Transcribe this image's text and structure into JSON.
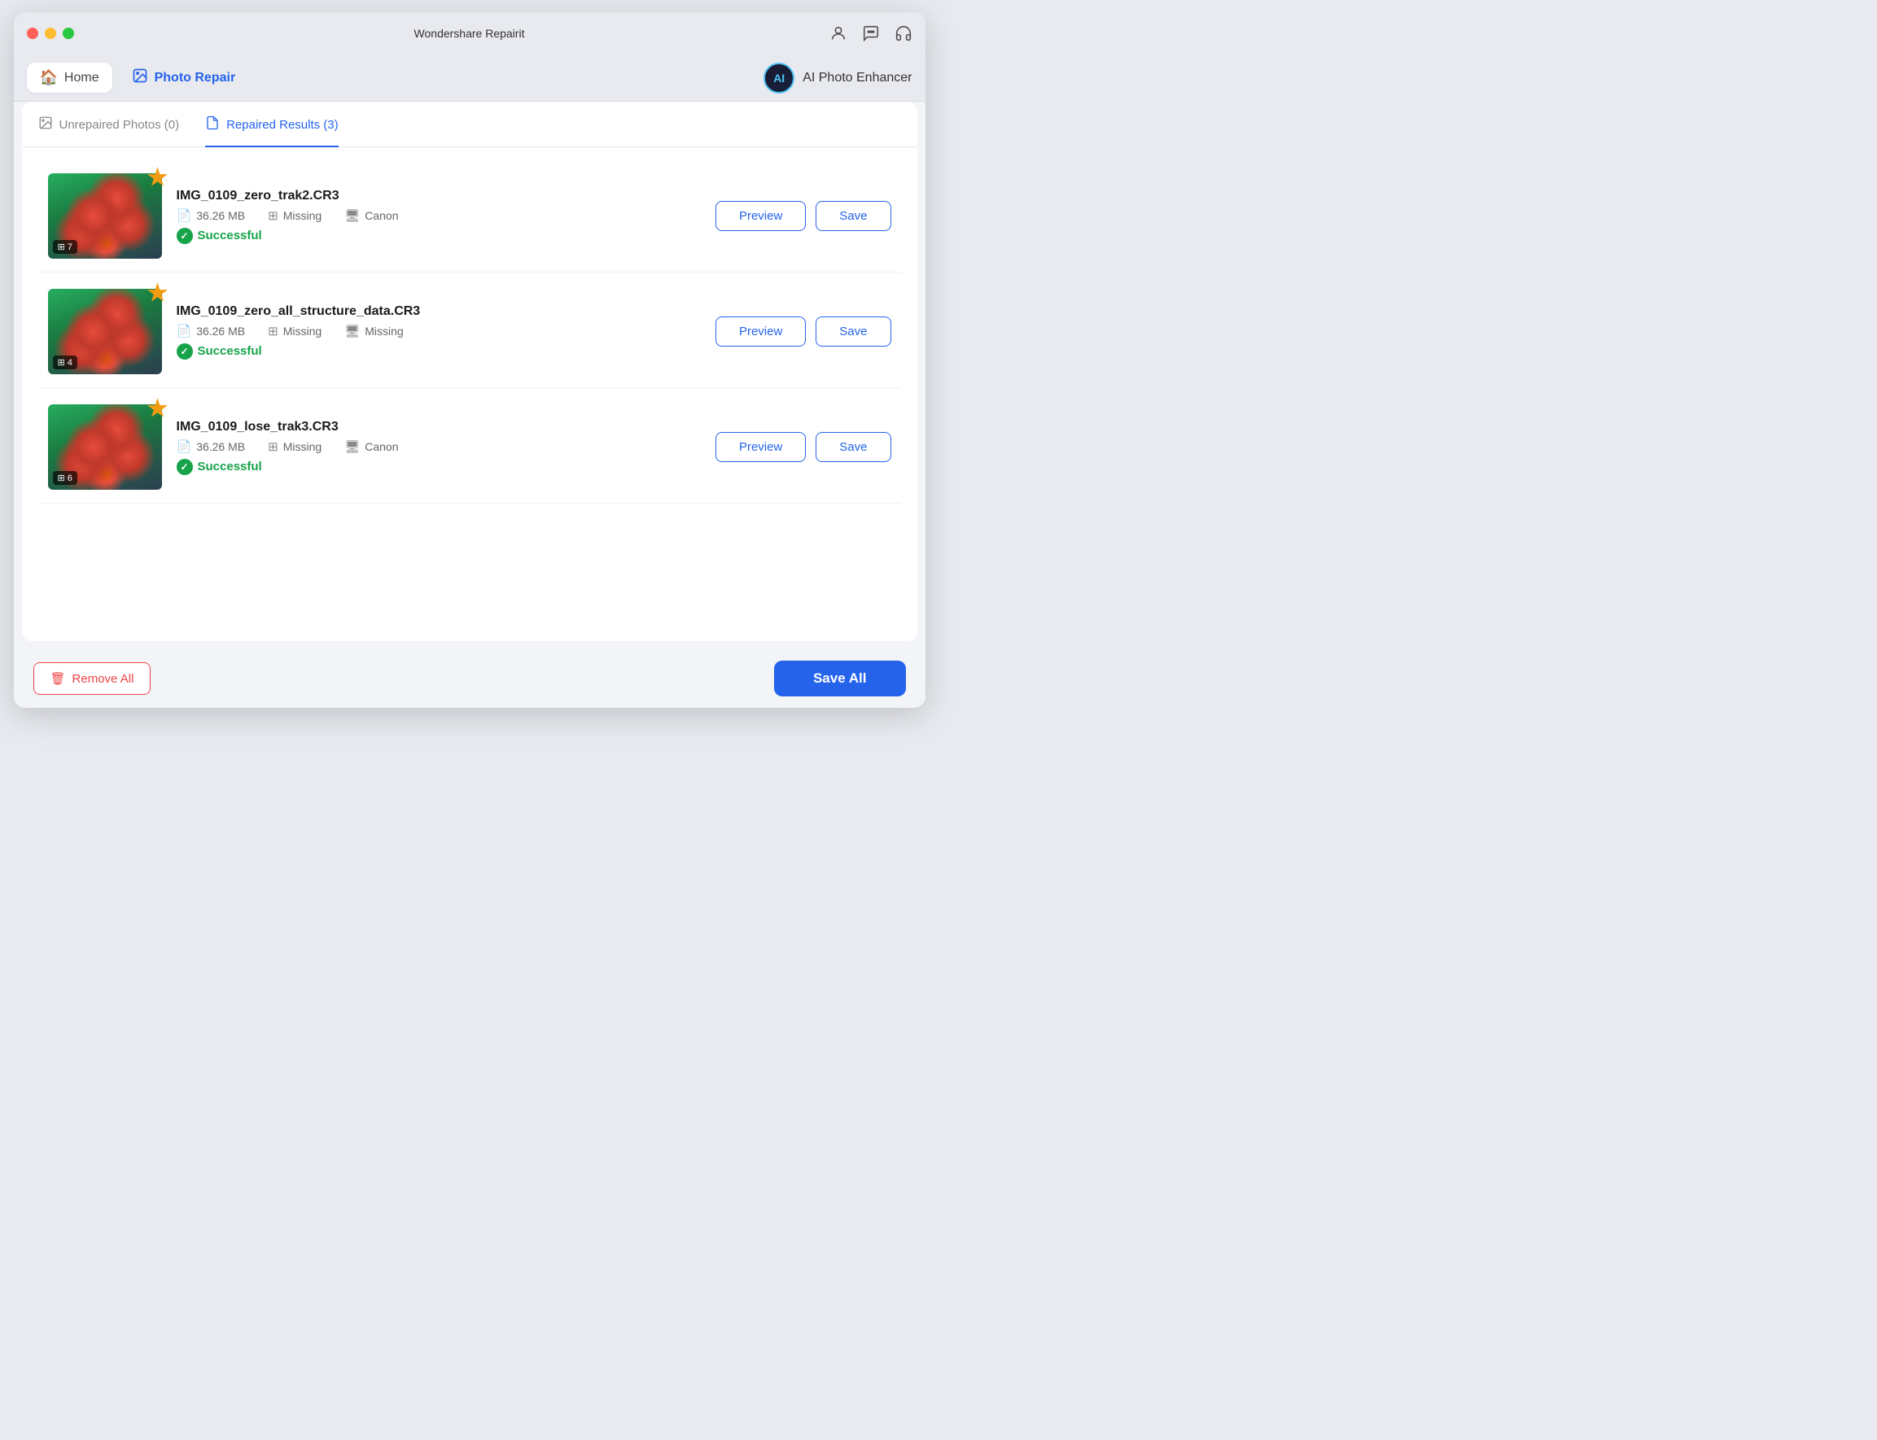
{
  "window": {
    "title": "Wondershare Repairit"
  },
  "navbar": {
    "home_label": "Home",
    "photo_repair_label": "Photo Repair",
    "ai_enhancer_label": "AI Photo Enhancer",
    "ai_icon_text": "AI"
  },
  "tabs": [
    {
      "id": "unrepaired",
      "label": "Unrepaired Photos (0)",
      "active": false
    },
    {
      "id": "repaired",
      "label": "Repaired Results (3)",
      "active": true
    }
  ],
  "photos": [
    {
      "id": 1,
      "name": "IMG_0109_zero_trak2.CR3",
      "size": "36.26 MB",
      "issue": "Missing",
      "device": "Canon",
      "status": "Successful",
      "badge_count": "7"
    },
    {
      "id": 2,
      "name": "IMG_0109_zero_all_structure_data.CR3",
      "size": "36.26 MB",
      "issue": "Missing",
      "device": "Missing",
      "status": "Successful",
      "badge_count": "4"
    },
    {
      "id": 3,
      "name": "IMG_0109_lose_trak3.CR3",
      "size": "36.26 MB",
      "issue": "Missing",
      "device": "Canon",
      "status": "Successful",
      "badge_count": "6"
    }
  ],
  "buttons": {
    "preview": "Preview",
    "save": "Save",
    "remove_all": "Remove All",
    "save_all": "Save All"
  }
}
